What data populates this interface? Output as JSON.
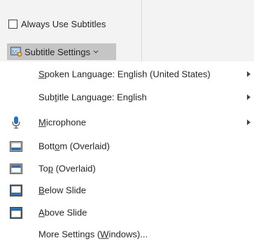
{
  "ribbon": {
    "always_use_subtitles": {
      "label": "Always Use Subtitles",
      "checked": false
    },
    "subtitle_settings_button": {
      "label": "Subtitle Settings",
      "icon": "closed-caption-icon"
    }
  },
  "menu": {
    "items": [
      {
        "pre": "",
        "key": "S",
        "post": "poken Language: English (United States)",
        "icon": "",
        "submenu": true
      },
      {
        "pre": "Sub",
        "key": "t",
        "post": "itle Language: English",
        "icon": "",
        "submenu": true
      },
      {
        "pre": "",
        "key": "M",
        "post": "icrophone",
        "icon": "microphone-icon",
        "submenu": true
      },
      {
        "pre": "Bott",
        "key": "o",
        "post": "m (Overlaid)",
        "icon": "screen-bottom-overlay-icon",
        "submenu": false
      },
      {
        "pre": "To",
        "key": "p",
        "post": " (Overlaid)",
        "icon": "screen-top-overlay-icon",
        "submenu": false
      },
      {
        "pre": "",
        "key": "B",
        "post": "elow Slide",
        "icon": "screen-below-slide-icon",
        "submenu": false
      },
      {
        "pre": "",
        "key": "A",
        "post": "bove Slide",
        "icon": "screen-above-slide-icon",
        "submenu": false
      },
      {
        "pre": "More Settings (",
        "key": "W",
        "post": "indows)...",
        "icon": "",
        "submenu": false
      }
    ]
  },
  "colors": {
    "ribbon_bg": "#f3f3f3",
    "button_pressed_bg": "#c5c5c5",
    "icon_blue": "#2f6fb5",
    "text": "#262626"
  }
}
